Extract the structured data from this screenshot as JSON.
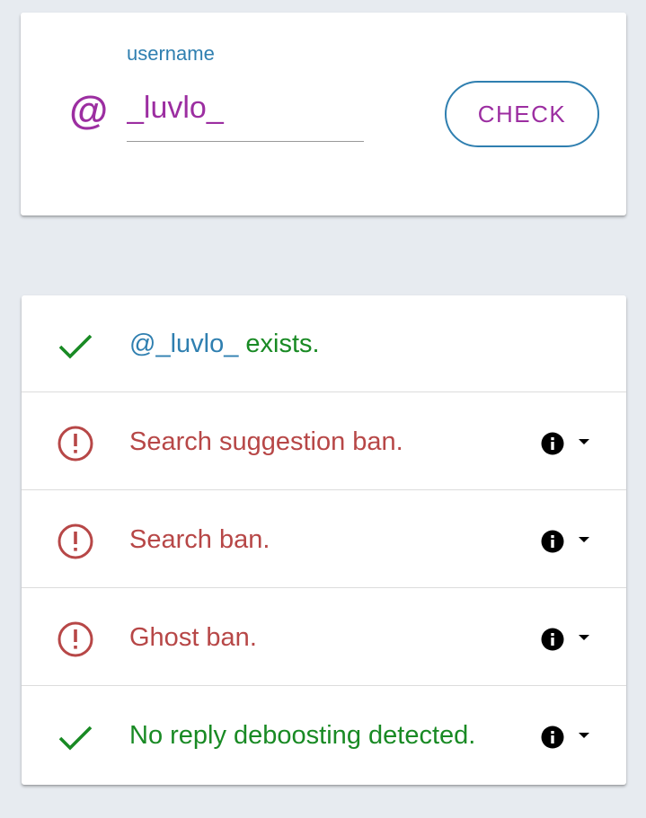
{
  "search": {
    "at_symbol": "@",
    "field_label": "username",
    "username_value": "_luvlo_",
    "check_label": "CHECK"
  },
  "results": {
    "items": [
      {
        "status": "ok",
        "icon": "check-icon",
        "handle": "@_luvlo_",
        "text": " exists.",
        "has_info": false
      },
      {
        "status": "error",
        "icon": "alert-circle-icon",
        "text": "Search suggestion ban.",
        "has_info": true
      },
      {
        "status": "error",
        "icon": "alert-circle-icon",
        "text": "Search ban.",
        "has_info": true
      },
      {
        "status": "error",
        "icon": "alert-circle-icon",
        "text": "Ghost ban.",
        "has_info": true
      },
      {
        "status": "ok",
        "icon": "check-icon",
        "text": "No reply deboosting detected.",
        "has_info": true
      }
    ]
  },
  "colors": {
    "accent_purple": "#9c2ea1",
    "accent_blue": "#2f7fb0",
    "ok_green": "#198a24",
    "error_red": "#b74747",
    "background": "#e7ebf0"
  }
}
